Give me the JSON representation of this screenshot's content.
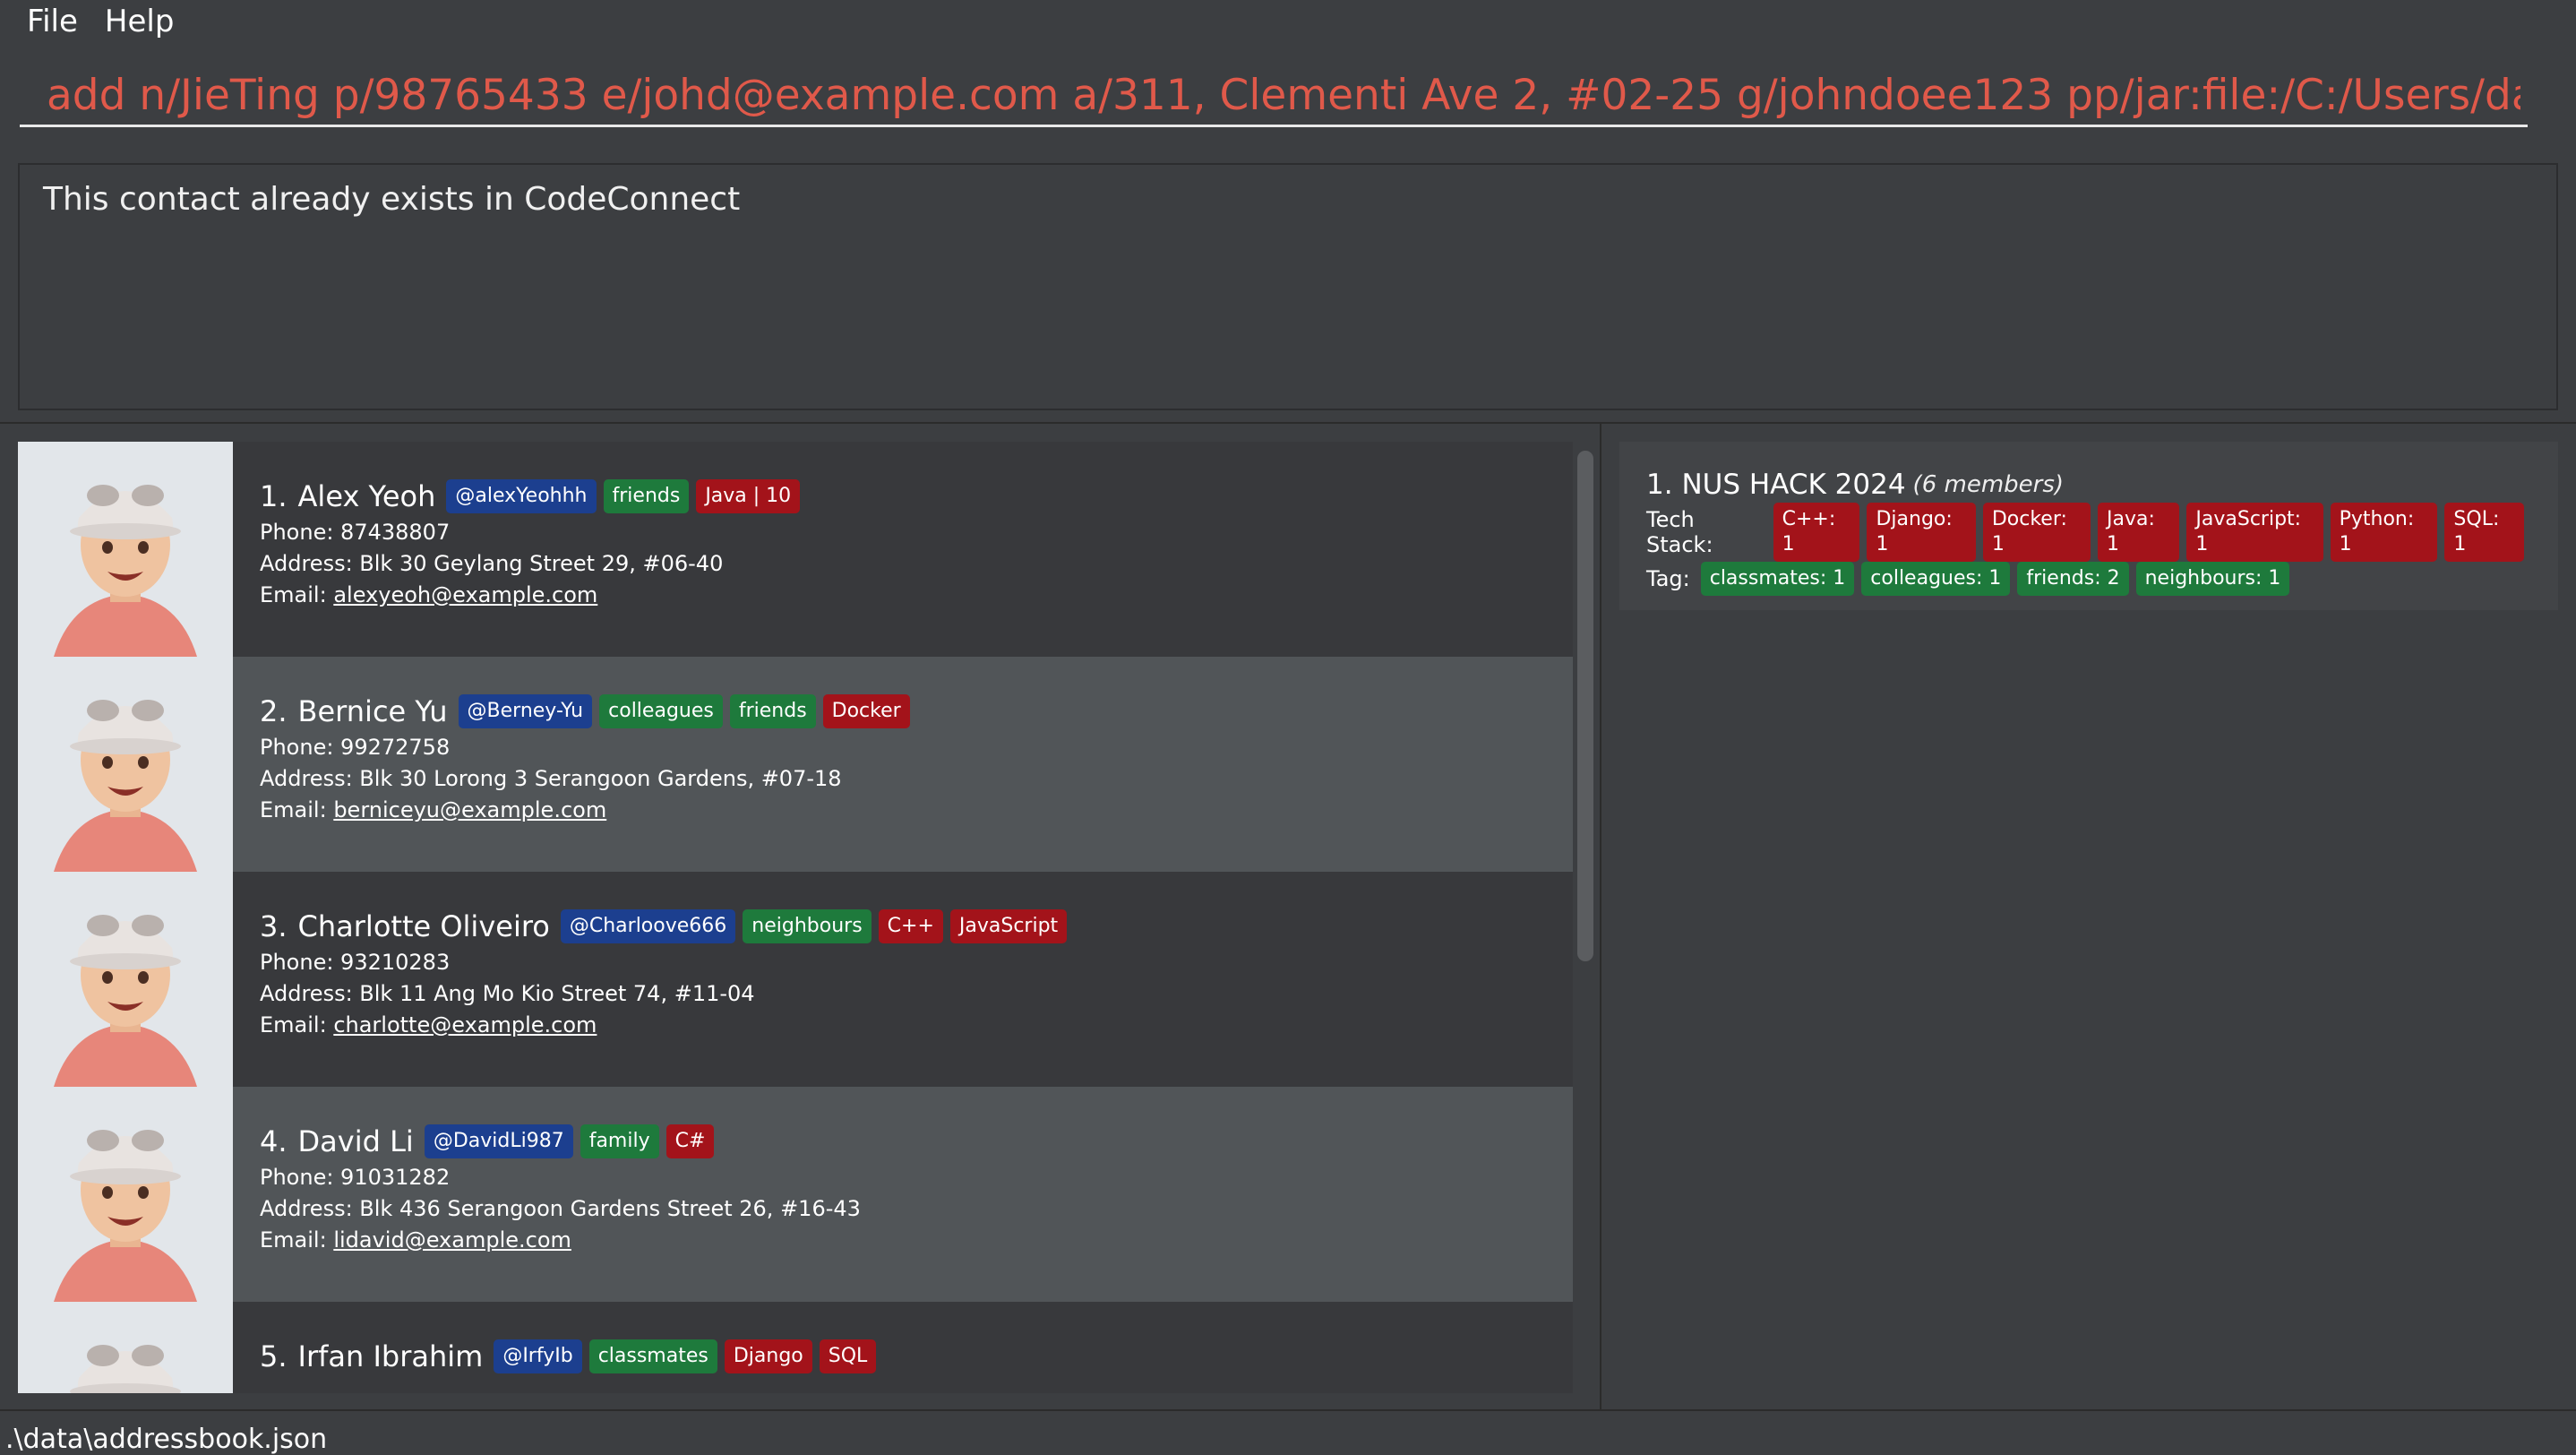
{
  "menu": {
    "file": "File",
    "help": "Help"
  },
  "command": {
    "value": "add n/JieTing p/98765433 e/johd@example.com a/311, Clementi Ave 2, #02-25 g/johndoee123 pp/jar:file:/C:/Users/darka/Downloa"
  },
  "result": {
    "text": "This contact already exists in CodeConnect"
  },
  "contacts": [
    {
      "index": "1.",
      "name": "Alex Yeoh",
      "github": "@alexYeohhh",
      "tags": [
        "friends"
      ],
      "tech": [
        "Java | 10"
      ],
      "phone": "Phone: 87438807",
      "address": "Address: Blk 30 Geylang Street 29, #06-40",
      "email_label": "Email: ",
      "email": "alexyeoh@example.com"
    },
    {
      "index": "2.",
      "name": "Bernice Yu",
      "github": "@Berney-Yu",
      "tags": [
        "colleagues",
        "friends"
      ],
      "tech": [
        "Docker"
      ],
      "phone": "Phone: 99272758",
      "address": "Address: Blk 30 Lorong 3 Serangoon Gardens, #07-18",
      "email_label": "Email: ",
      "email": "berniceyu@example.com"
    },
    {
      "index": "3.",
      "name": "Charlotte Oliveiro",
      "github": "@Charloove666",
      "tags": [
        "neighbours"
      ],
      "tech": [
        "C++",
        "JavaScript"
      ],
      "phone": "Phone: 93210283",
      "address": "Address: Blk 11 Ang Mo Kio Street 74, #11-04",
      "email_label": "Email: ",
      "email": "charlotte@example.com"
    },
    {
      "index": "4.",
      "name": "David Li",
      "github": "@DavidLi987",
      "tags": [
        "family"
      ],
      "tech": [
        "C#"
      ],
      "phone": "Phone: 91031282",
      "address": "Address: Blk 436 Serangoon Gardens Street 26, #16-43",
      "email_label": "Email: ",
      "email": "lidavid@example.com"
    },
    {
      "index": "5.",
      "name": "Irfan Ibrahim",
      "github": "@IrfyIb",
      "tags": [
        "classmates"
      ],
      "tech": [
        "Django",
        "SQL"
      ],
      "phone": "",
      "address": "",
      "email_label": "",
      "email": ""
    }
  ],
  "group": {
    "index": "1.",
    "name": "NUS HACK 2024",
    "members": "(6 members)",
    "tech_label": "Tech Stack:",
    "tech": [
      "C++: 1",
      "Django: 1",
      "Docker: 1",
      "Java: 1",
      "JavaScript: 1",
      "Python: 1",
      "SQL: 1"
    ],
    "tag_label": "Tag:",
    "tags": [
      "classmates: 1",
      "colleagues: 1",
      "friends: 2",
      "neighbours: 1"
    ]
  },
  "status": {
    "path": ".\\data\\addressbook.json"
  },
  "colors": {
    "background": "#3c3e41",
    "command_text": "#e0594a",
    "github_tag": "#1c3f8f",
    "group_tag": "#1e7a3c",
    "tech_tag": "#a3131a"
  }
}
